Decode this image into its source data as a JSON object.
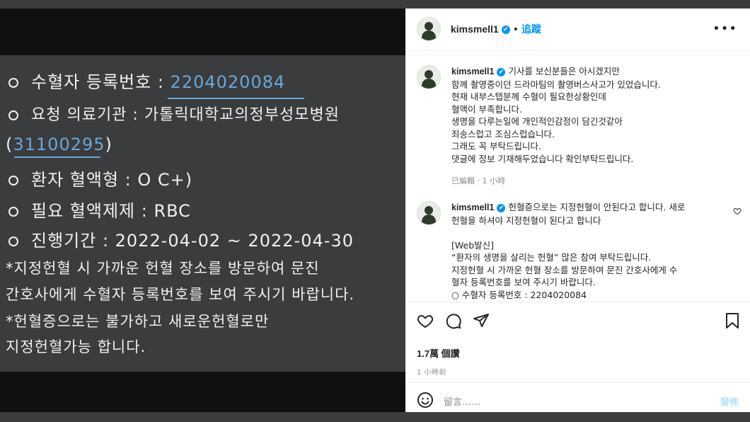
{
  "photo": {
    "lines": [
      {
        "prefix": "수혈자 등록번호 : ",
        "value": "2204020084"
      },
      {
        "text": "요청 의료기관 : 가톨릭대학교의정부성모병원"
      },
      {
        "open": "(",
        "value": "31100295",
        "close": ")"
      },
      {
        "text": "환자 혈액형 : O C+)"
      },
      {
        "text": "필요 혈액제제 : RBC"
      },
      {
        "text": "진행기간 : 2022-04-02 ~ 2022-04-30"
      },
      {
        "text": "*지정헌혈 시 가까운 헌혈 장소를 방문하여 문진"
      },
      {
        "text": "간호사에게 수혈자 등록번호를 보여 주시기 바랍니다."
      },
      {
        "text": "*헌혈증으로는 불가하고 새로운헌혈로만"
      },
      {
        "text": "지정헌혈가능 합니다."
      }
    ]
  },
  "header": {
    "username": "kimsmell1",
    "verified": "✔",
    "separator": "•",
    "follow": "追蹤",
    "more": "•••"
  },
  "caption": {
    "username": "kimsmell1",
    "verified": "✔",
    "lines": [
      "기사를 보신분들은 아시겠지만",
      "함께 촬영중이던 드라마팀의 촬영버스사고가 있었습니다.",
      "현재 내부스텝분께 수혈이 필요한상황인데",
      "혈액이 부족합니다.",
      "생명을 다루는일에 개인적인감정이 담긴것같아",
      "죄송스럽고 조심스럽습니다.",
      "그래도 꼭 부탁드립니다.",
      "댓글에 정보 기재해두었습니다 확인부탁드립니다."
    ],
    "meta": "已編輯 · 1 小時"
  },
  "comment": {
    "username": "kimsmell1",
    "verified": "✔",
    "lines": [
      "헌혈증으로는 지정헌혈이 안된다고 합니다. 새로",
      "헌혈을 하셔야 지정헌혈이 된다고 합니다",
      "",
      "[Web발신]",
      "“환자의 생명을 살리는 헌혈” 많은 참여 부탁드립니다.",
      "지정헌혈 시 가까운 헌혈 장소를 방문하여 문진 간호사에게 수",
      "혈자 등록번호를 보여 주시기 바랍니다.",
      "○ 수혈자 등록번호 : 2204020084"
    ]
  },
  "actions": {
    "likes": "1.7萬 個讚",
    "time": "1 小時前",
    "comment_placeholder": "留言……",
    "post": "發佈",
    "icons": [
      "heart-icon",
      "comment-icon",
      "share-icon",
      "bookmark-icon",
      "emoji-icon"
    ]
  },
  "colors": {
    "accent": "#0095f6",
    "board": "#3b3c3e",
    "ink_blue": "#6aa7d8"
  }
}
